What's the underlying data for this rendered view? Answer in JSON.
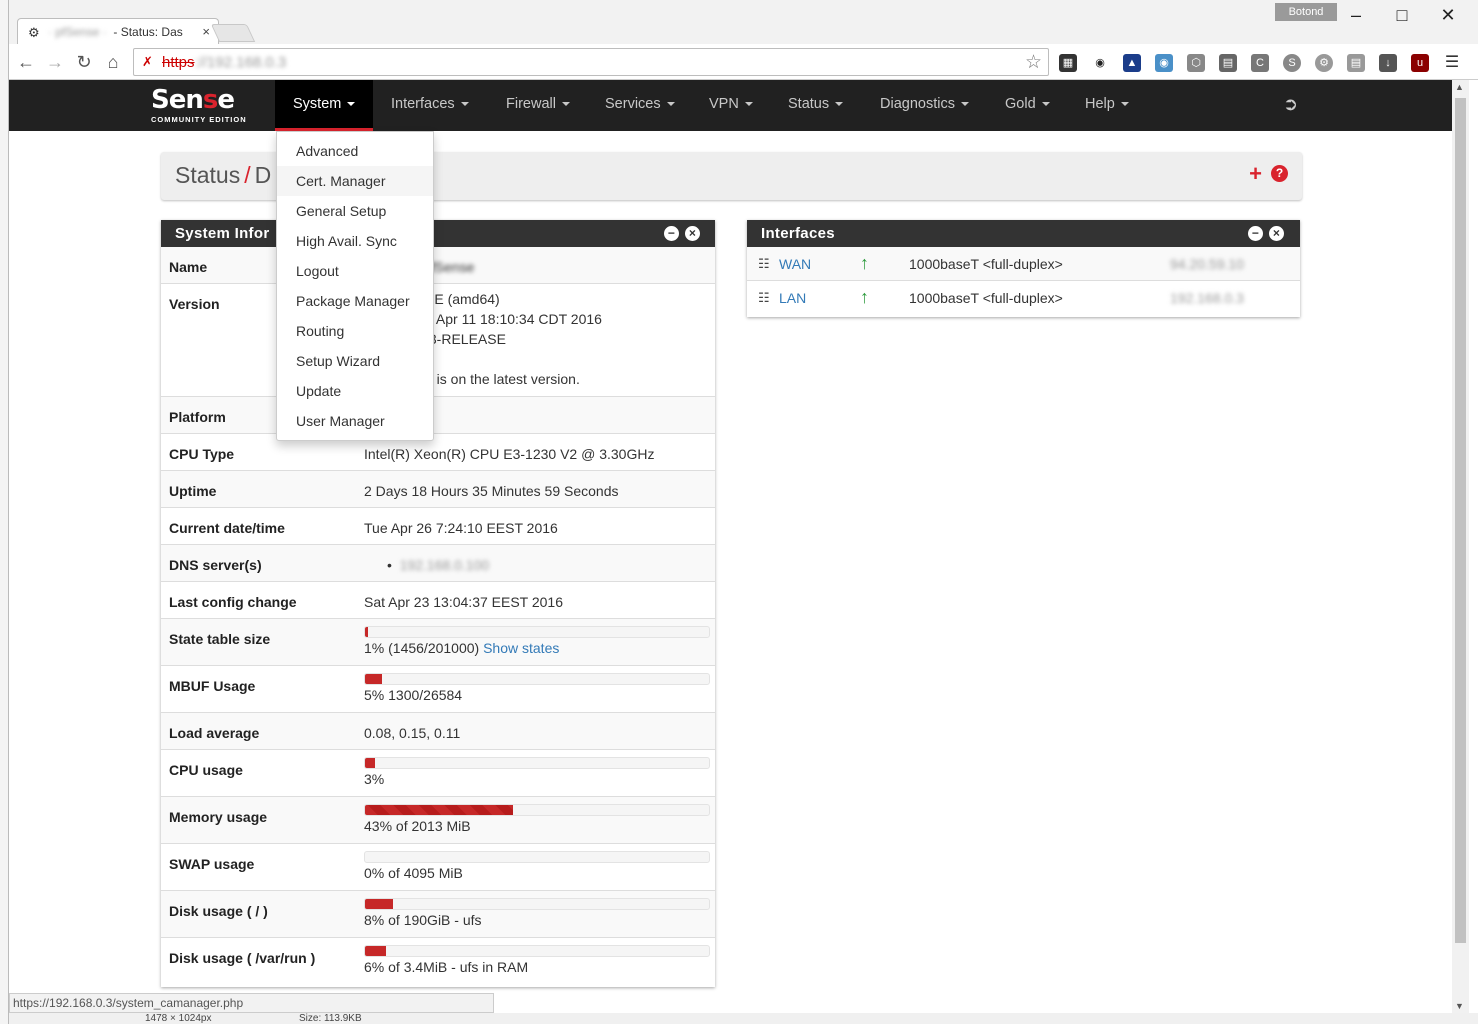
{
  "browser": {
    "tab_title": "Status: Das",
    "tab_title_blurred": "· pfSense ·",
    "tab_close": "×",
    "profile": "Botond",
    "url_scheme": "https",
    "url_rest": "://192.168.0.3",
    "window_controls": [
      "–",
      "□",
      "✕"
    ]
  },
  "navbar": {
    "brand_main": "Sen",
    "brand_accent": "s",
    "brand_end": "e",
    "edition": "COMMUNITY EDITION",
    "items": [
      {
        "label": "System",
        "active": true
      },
      {
        "label": "Interfaces"
      },
      {
        "label": "Firewall"
      },
      {
        "label": "Services"
      },
      {
        "label": "VPN"
      },
      {
        "label": "Status"
      },
      {
        "label": "Diagnostics"
      },
      {
        "label": "Gold"
      },
      {
        "label": "Help"
      }
    ]
  },
  "dropdown": {
    "items": [
      "Advanced",
      "Cert. Manager",
      "General Setup",
      "High Avail. Sync",
      "Logout",
      "Package Manager",
      "Routing",
      "Setup Wizard",
      "Update",
      "User Manager"
    ],
    "hovered": "Cert. Manager"
  },
  "breadcrumb": {
    "part1": "Status",
    "sep": "/",
    "part2": "D"
  },
  "sysinfo": {
    "title": "System Infor",
    "rows": {
      "name": {
        "label": "Name",
        "value": "pfSense"
      },
      "version": {
        "label": "Version",
        "line1": "SE (amd64)",
        "line2": "n Apr 11 18:10:34 CDT 2016",
        "line3": ".3-RELEASE",
        "line4": "n is on the latest version."
      },
      "platform": {
        "label": "Platform"
      },
      "cpu_type": {
        "label": "CPU Type",
        "value": "Intel(R) Xeon(R) CPU E3-1230 V2 @ 3.30GHz"
      },
      "uptime": {
        "label": "Uptime",
        "value": "2 Days 18 Hours 35 Minutes 59 Seconds"
      },
      "datetime": {
        "label": "Current date/time",
        "value": "Tue Apr 26 7:24:10 EEST 2016"
      },
      "dns": {
        "label": "DNS server(s)",
        "value": "192.168.0.100"
      },
      "last_config": {
        "label": "Last config change",
        "value": "Sat Apr 23 13:04:37 EEST 2016"
      },
      "state_table": {
        "label": "State table size",
        "value": "1% (1456/201000)",
        "link": "Show states",
        "percent": 1
      },
      "mbuf": {
        "label": "MBUF Usage",
        "value": "5% 1300/26584",
        "percent": 5
      },
      "load": {
        "label": "Load average",
        "value": "0.08, 0.15, 0.11"
      },
      "cpu_usage": {
        "label": "CPU usage",
        "value": "3%",
        "percent": 3
      },
      "memory": {
        "label": "Memory usage",
        "value": "43% of 2013 MiB",
        "percent": 43
      },
      "swap": {
        "label": "SWAP usage",
        "value": "0% of 4095 MiB",
        "percent": 0
      },
      "disk_root": {
        "label": "Disk usage ( / )",
        "value": "8% of 190GiB - ufs",
        "percent": 8
      },
      "disk_run": {
        "label": "Disk usage ( /var/run )",
        "value": "6% of 3.4MiB - ufs in RAM",
        "percent": 6
      }
    }
  },
  "interfaces": {
    "title": "Interfaces",
    "rows": [
      {
        "name": "WAN",
        "media": "1000baseT <full-duplex>",
        "ip": "94.20.59.10"
      },
      {
        "name": "LAN",
        "media": "1000baseT <full-duplex>",
        "ip": "192.168.0.3"
      }
    ]
  },
  "statusbar": {
    "url": "https://192.168.0.3/system_camanager.php"
  },
  "bottom": {
    "left": "1478 × 1024px",
    "right": "Size: 113.9KB"
  },
  "colors": {
    "accent": "#d9232d",
    "navbar": "#212121",
    "panel_head": "#333333",
    "bar": "#c62828",
    "status_up": "#2e9b3e",
    "link": "#337ab7"
  }
}
